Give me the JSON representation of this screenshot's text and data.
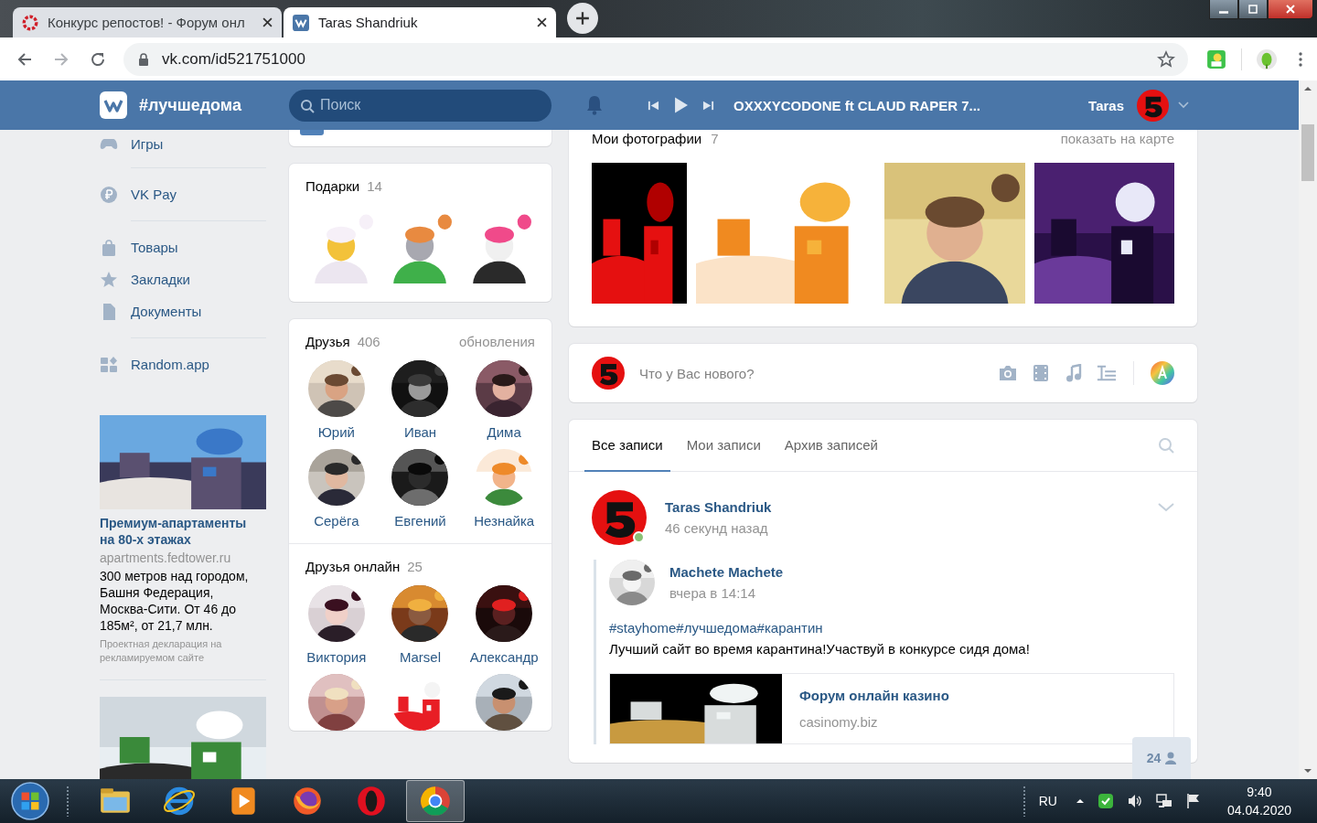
{
  "browser": {
    "tabs": [
      {
        "title": "Конкурс репостов! - Форум онл",
        "selected": false
      },
      {
        "title": "Taras Shandriuk",
        "selected": true
      }
    ],
    "url": "vk.com/id521751000"
  },
  "header": {
    "site_title": "#лучшедома",
    "search": {
      "placeholder": "Поиск"
    },
    "track": "OXXXYCODONE ft CLAUD RAPER 7...",
    "user": "Taras"
  },
  "sidebar": {
    "groups": [
      [
        {
          "label": "Игры",
          "kind": "games"
        }
      ],
      [
        {
          "label": "VK Pay",
          "kind": "pay"
        }
      ],
      [
        {
          "label": "Товары",
          "kind": "market"
        },
        {
          "label": "Закладки",
          "kind": "bookmarks"
        },
        {
          "label": "Документы",
          "kind": "docs"
        }
      ],
      [
        {
          "label": "Random.app",
          "kind": "apps"
        }
      ]
    ],
    "ads": [
      {
        "title": "Премиум-апартаменты на 80-х этажах",
        "domain": "apartments.fedtower.ru",
        "text": "300 метров над городом, Башня Федерация, Москва-Сити. От 46 до 185м², от 21,7 млн.",
        "note": "Проектная декларация на рекламируемом сайте"
      },
      {
        "kind": "picture"
      }
    ]
  },
  "gifts": {
    "title": "Подарки",
    "count": "14",
    "items": [
      {
        "kind": "picture"
      },
      {
        "kind": "picture"
      },
      {
        "kind": "picture"
      }
    ]
  },
  "friends": {
    "title": "Друзья",
    "count": "406",
    "link": "обновления",
    "items": [
      {
        "name": "Юрий"
      },
      {
        "name": "Иван"
      },
      {
        "name": "Дима"
      },
      {
        "name": "Серёга"
      },
      {
        "name": "Евгений"
      },
      {
        "name": "Незнайка"
      }
    ]
  },
  "online_friends": {
    "title": "Друзья онлайн",
    "count": "25",
    "items": [
      {
        "name": "Виктория"
      },
      {
        "name": "Marsel"
      },
      {
        "name": "Александр"
      },
      {
        "kind": "picture"
      },
      {
        "kind": "picture"
      },
      {
        "kind": "picture"
      }
    ]
  },
  "photos": {
    "title": "Мои фотографии",
    "count": "7",
    "link": "показать на карте",
    "items": [
      {
        "kind": "picture"
      },
      {
        "kind": "picture"
      },
      {
        "kind": "picture"
      },
      {
        "kind": "picture"
      }
    ]
  },
  "composer": {
    "placeholder": "Что у Вас нового?"
  },
  "wall": {
    "tabs": [
      {
        "label": "Все записи",
        "selected": true
      },
      {
        "label": "Мои записи",
        "selected": false
      },
      {
        "label": "Архив записей",
        "selected": false
      }
    ],
    "post": {
      "author": "Taras Shandriuk",
      "time": "46 секунд назад",
      "online": true,
      "repost": {
        "author": "Machete Machete",
        "time": "вчера в 14:14",
        "tags": "#stayhome#лучшедома#карантин",
        "text": "Лучший сайт во время карантина!Участвуй в конкурсе сидя дома!",
        "link": {
          "title": "Форум онлайн казино",
          "domain": "casinomy.biz"
        }
      }
    }
  },
  "online_button": {
    "count": "24"
  },
  "taskbar": {
    "apps": [
      {
        "kind": "explorer",
        "selected": false
      },
      {
        "kind": "ie",
        "selected": false
      },
      {
        "kind": "media",
        "selected": false
      },
      {
        "kind": "firefox",
        "selected": false
      },
      {
        "kind": "opera",
        "selected": false
      },
      {
        "kind": "chrome",
        "selected": true
      }
    ],
    "language": "RU",
    "time": "9:40",
    "date": "04.04.2020"
  }
}
